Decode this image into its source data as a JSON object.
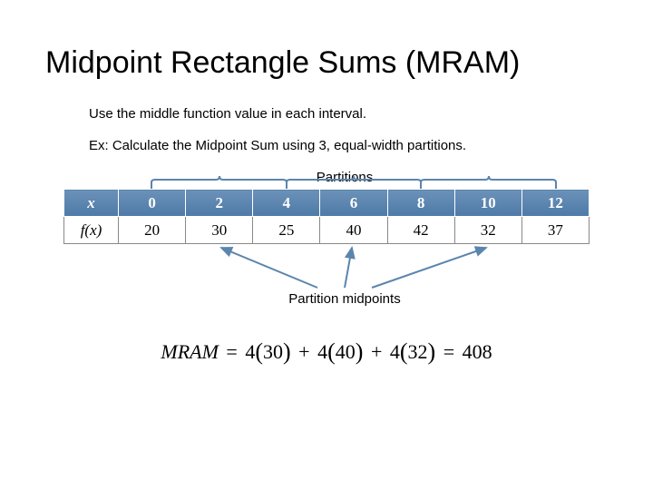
{
  "title": "Midpoint Rectangle Sums (MRAM)",
  "instruction": "Use the middle function value in each interval.",
  "example": "Ex: Calculate the Midpoint Sum using 3, equal-width partitions.",
  "partitions_label": "Partitions",
  "midpoints_label": "Partition midpoints",
  "table": {
    "row1_head": "x",
    "row2_head": "f(x)",
    "x": [
      "0",
      "2",
      "4",
      "6",
      "8",
      "10",
      "12"
    ],
    "fx": [
      "20",
      "30",
      "25",
      "40",
      "42",
      "32",
      "37"
    ]
  },
  "formula": {
    "lhs": "MRAM",
    "t1_coef": "4",
    "t1_val": "30",
    "t2_coef": "4",
    "t2_val": "40",
    "t3_coef": "4",
    "t3_val": "32",
    "result": "408"
  }
}
